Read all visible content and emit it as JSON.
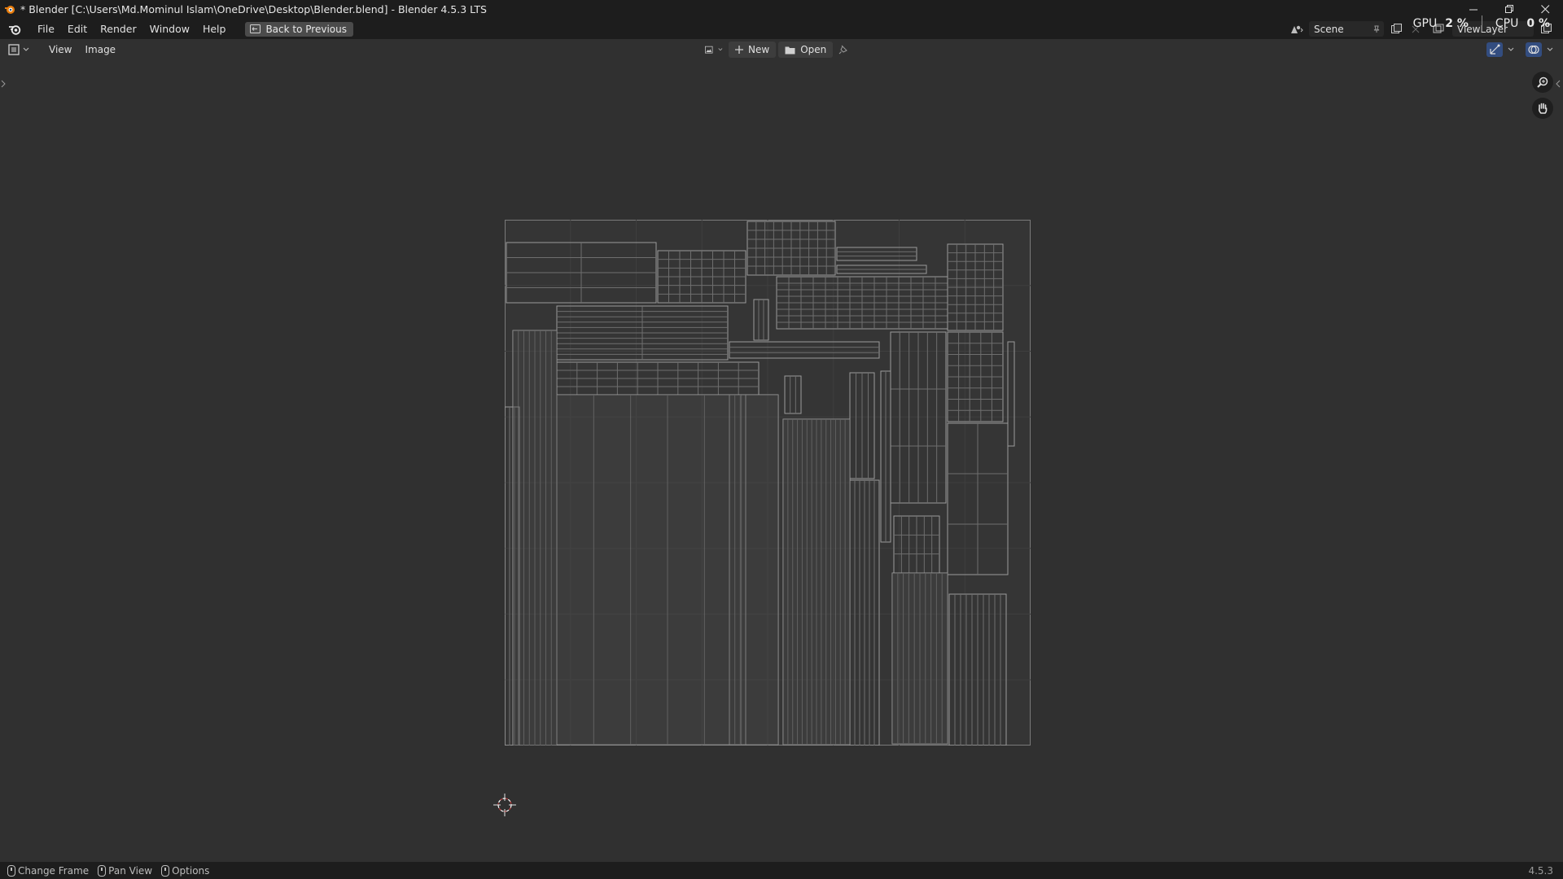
{
  "window": {
    "title": "* Blender [C:\\Users\\Md.Mominul Islam\\OneDrive\\Desktop\\Blender.blend] - Blender 4.5.3 LTS",
    "controls": [
      "minimize",
      "restore",
      "close"
    ]
  },
  "perf": {
    "gpu_label": "GPU",
    "gpu_value": "2 %",
    "cpu_label": "CPU",
    "cpu_value": "0 %"
  },
  "menubar": {
    "items": [
      "File",
      "Edit",
      "Render",
      "Window",
      "Help"
    ],
    "back_button": "Back to Previous",
    "scene": "Scene",
    "view_layer": "ViewLayer"
  },
  "editor_header": {
    "menus": [
      "View",
      "Image"
    ],
    "new_label": "New",
    "open_label": "Open"
  },
  "statusbar": {
    "hints": [
      "Change Frame",
      "Pan View",
      "Options"
    ],
    "version": "4.5.3"
  },
  "colors": {
    "bg": "#303030",
    "bar": "#1d1d1d",
    "wire": "#8a8a8a",
    "accent": "#334d80"
  }
}
